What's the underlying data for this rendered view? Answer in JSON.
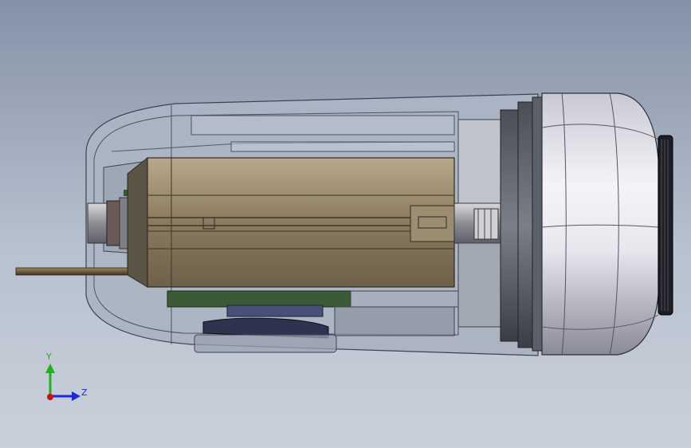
{
  "viewport": {
    "background_top": "#8592a6",
    "background_bottom": "#c9d0da"
  },
  "triad": {
    "y_label": "Y",
    "z_label": "Z",
    "y_color": "#1bb51b",
    "z_color": "#1a2ae0",
    "origin_color": "#d01010"
  },
  "model": {
    "icons": [
      "motor-assembly-icon",
      "shaft-icon",
      "end-cap-icon",
      "gear-ring-icon",
      "circuit-board-icon"
    ]
  }
}
